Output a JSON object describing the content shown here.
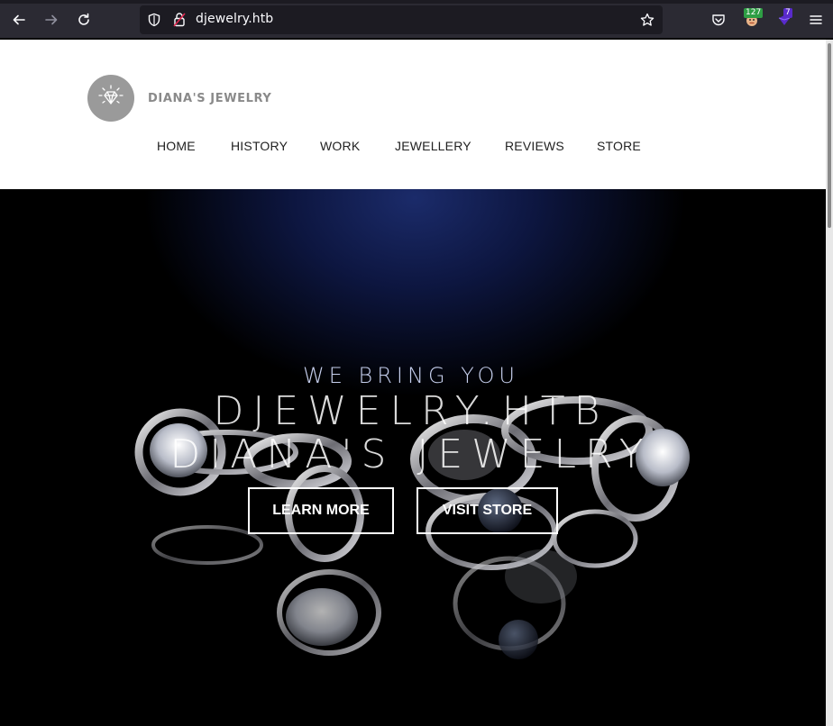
{
  "browser": {
    "url": "djewelry.htb",
    "extensions": [
      {
        "name": "pocket-icon"
      },
      {
        "name": "extension-a-icon",
        "badge": "127",
        "badge_color": "#2e9e44"
      },
      {
        "name": "extension-b-icon",
        "badge": "7",
        "badge_color": "#592acb"
      }
    ]
  },
  "site": {
    "brand": "DIANA'S JEWELRY",
    "nav": [
      "HOME",
      "HISTORY",
      "WORK",
      "JEWELLERY",
      "REVIEWS",
      "STORE"
    ],
    "hero": {
      "subtitle": "WE BRING YOU",
      "title_line1": "DJEWELRY.HTB",
      "title_line2": "DIANA'S JEWELRY",
      "buttons": [
        "LEARN MORE",
        "VISIT STORE"
      ]
    }
  },
  "colors": {
    "hero_glow": "#1b2b6a",
    "brand_gray": "#8a8a8a",
    "chrome_bg": "#2b2a33"
  }
}
